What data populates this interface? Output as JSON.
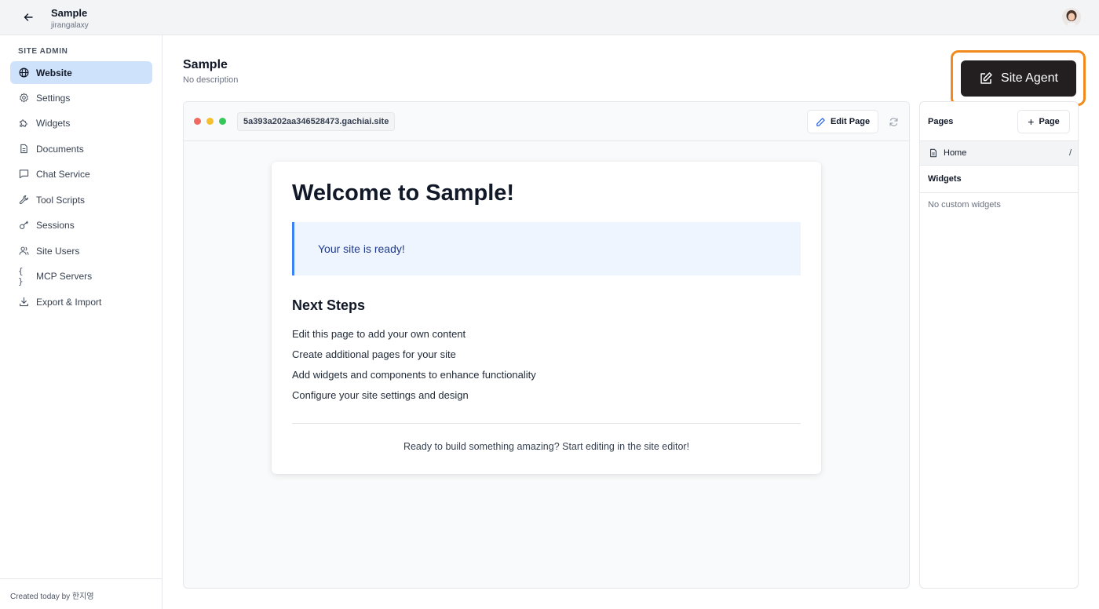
{
  "topbar": {
    "title": "Sample",
    "subtitle": "jirangalaxy"
  },
  "sidebar": {
    "heading": "SITE ADMIN",
    "items": [
      {
        "label": "Website",
        "icon": "globe-icon",
        "active": true
      },
      {
        "label": "Settings",
        "icon": "gear-icon",
        "active": false
      },
      {
        "label": "Widgets",
        "icon": "puzzle-icon",
        "active": false
      },
      {
        "label": "Documents",
        "icon": "document-icon",
        "active": false
      },
      {
        "label": "Chat Service",
        "icon": "chat-icon",
        "active": false
      },
      {
        "label": "Tool Scripts",
        "icon": "wrench-icon",
        "active": false
      },
      {
        "label": "Sessions",
        "icon": "key-icon",
        "active": false
      },
      {
        "label": "Site Users",
        "icon": "users-icon",
        "active": false
      },
      {
        "label": "MCP Servers",
        "icon": "braces-icon",
        "active": false
      },
      {
        "label": "Export & Import",
        "icon": "download-icon",
        "active": false
      }
    ],
    "footer": "Created today by 한지영"
  },
  "header": {
    "title": "Sample",
    "description": "No description",
    "agent_button": "Site Agent"
  },
  "preview": {
    "url": "5a393a202aa346528473.gachiai.site",
    "edit_button": "Edit Page",
    "content": {
      "heading": "Welcome to Sample!",
      "callout": "Your site is ready!",
      "subheading": "Next Steps",
      "steps": [
        "Edit this page to add your own content",
        "Create additional pages for your site",
        "Add widgets and components to enhance functionality",
        "Configure your site settings and design"
      ],
      "footer": "Ready to build something amazing? Start editing in the site editor!"
    }
  },
  "right_panel": {
    "pages_label": "Pages",
    "add_page_button": "Page",
    "pages": [
      {
        "name": "Home",
        "path": "/"
      }
    ],
    "widgets_label": "Widgets",
    "widgets_empty": "No custom widgets"
  },
  "colors": {
    "accent_active": "#cfe2fb",
    "agent_button_bg": "#231f20",
    "highlight": "#f08a1c",
    "callout_border": "#3b82f6"
  }
}
